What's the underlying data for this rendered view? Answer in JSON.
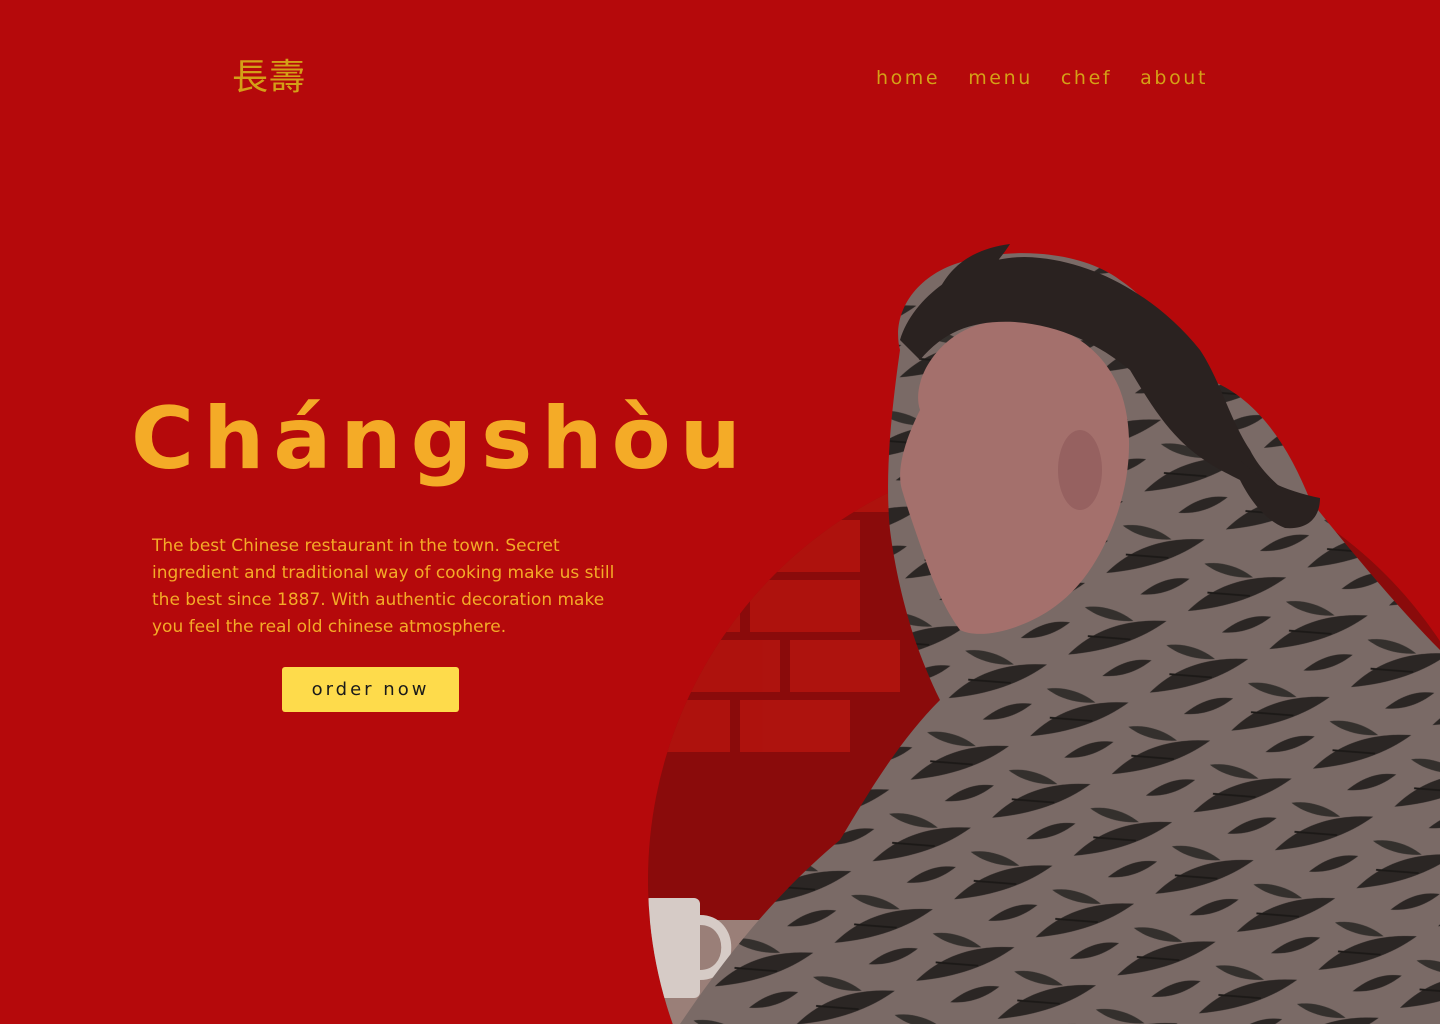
{
  "header": {
    "logo": "長壽",
    "nav": [
      "home",
      "menu",
      "chef",
      "about"
    ]
  },
  "hero": {
    "title": "Chángshòu",
    "description": "The best Chinese restaurant in the town. Secret ingredient and traditional way of cooking make us still the best since 1887. With authentic decoration make you feel the real old chinese atmosphere.",
    "cta_label": "order now"
  },
  "image": {
    "alt": "man in floral shirt sitting in red-lit restaurant"
  },
  "colors": {
    "background": "#b5090b",
    "accent": "#f4ab27",
    "button": "#fedb4b"
  }
}
